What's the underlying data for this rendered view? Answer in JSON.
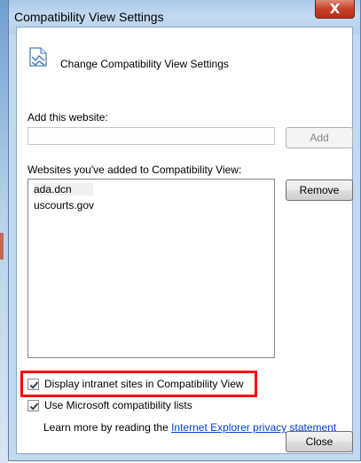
{
  "window": {
    "title": "Compatibility View Settings",
    "close_glyph": "X"
  },
  "header": {
    "icon": "compatibility-view-icon",
    "text": "Change Compatibility View Settings"
  },
  "add_website": {
    "label": "Add this website:",
    "value": "",
    "placeholder": "",
    "button_label": "Add"
  },
  "websites_list": {
    "label": "Websites you've added to Compatibility View:",
    "items": [
      "ada.dcn",
      "uscourts.gov"
    ],
    "remove_label": "Remove"
  },
  "options": {
    "intranet": {
      "label": "Display intranet sites in Compatibility View",
      "checked": true
    },
    "microsoft_lists": {
      "label": "Use Microsoft compatibility lists",
      "checked": true
    }
  },
  "privacy": {
    "prefix": "Learn more by reading the ",
    "link_text": "Internet Explorer privacy statement"
  },
  "footer": {
    "close_label": "Close"
  },
  "colors": {
    "highlight": "#ff0000",
    "link": "#0645c7",
    "title_bar": "#b7d0ea",
    "close_button": "#c7402a"
  }
}
